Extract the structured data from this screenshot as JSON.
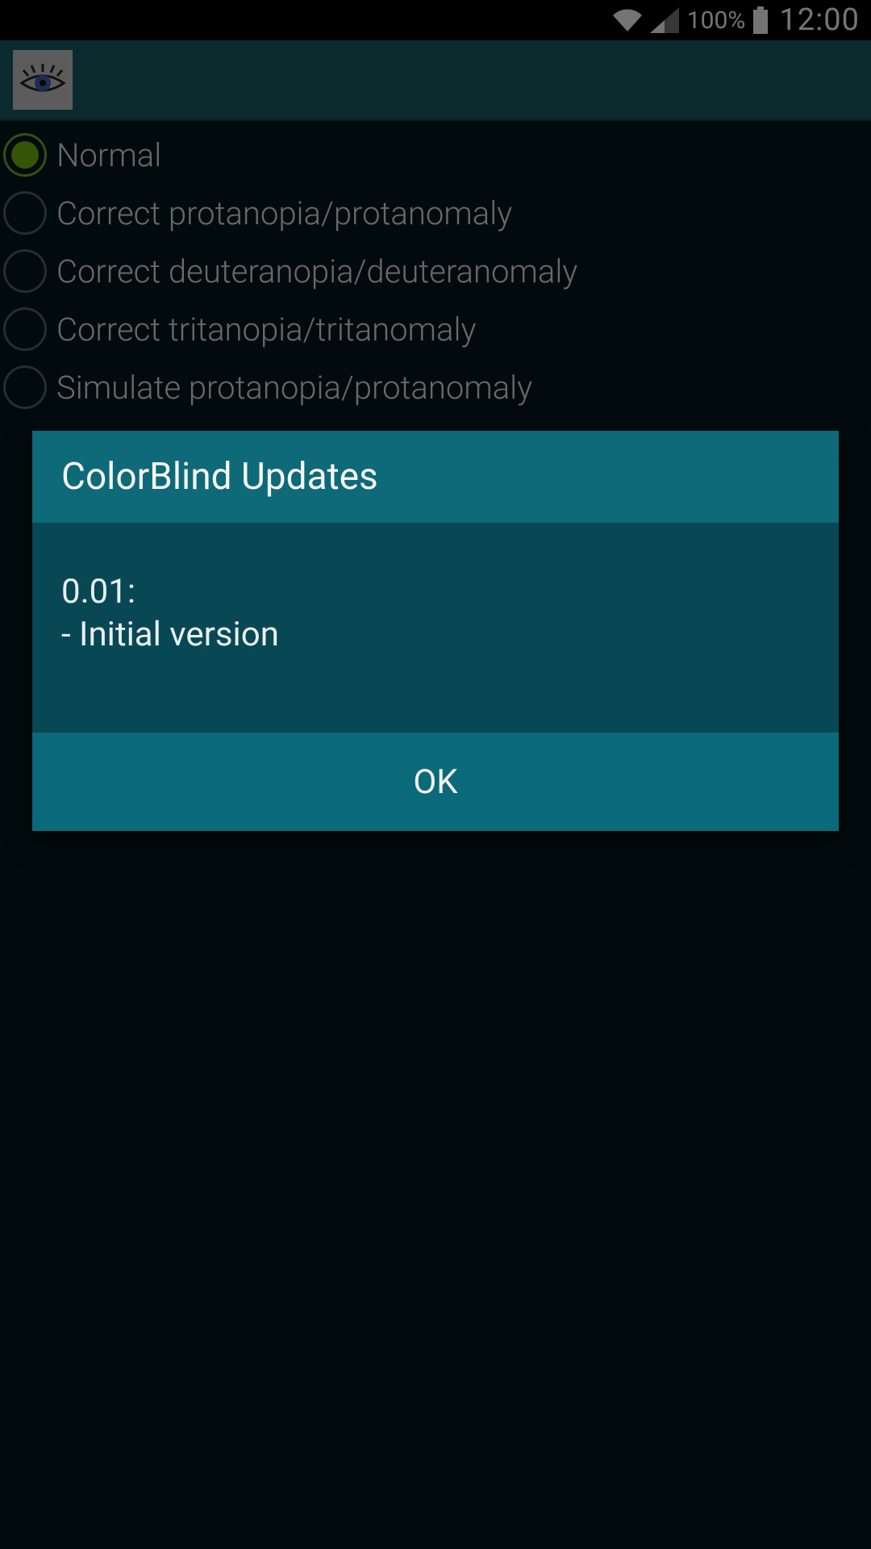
{
  "statusbar": {
    "battery_pct": "100%",
    "time": "12:00"
  },
  "radio_options": [
    {
      "label": "Normal",
      "selected": true
    },
    {
      "label": "Correct protanopia/protanomaly",
      "selected": false
    },
    {
      "label": "Correct deuteranopia/deuteranomaly",
      "selected": false
    },
    {
      "label": "Correct tritanopia/tritanomaly",
      "selected": false
    },
    {
      "label": "Simulate protanopia/protanomaly",
      "selected": false
    }
  ],
  "dialog": {
    "title": "ColorBlind Updates",
    "body": "0.01:\n- Initial version",
    "ok_label": "OK"
  }
}
